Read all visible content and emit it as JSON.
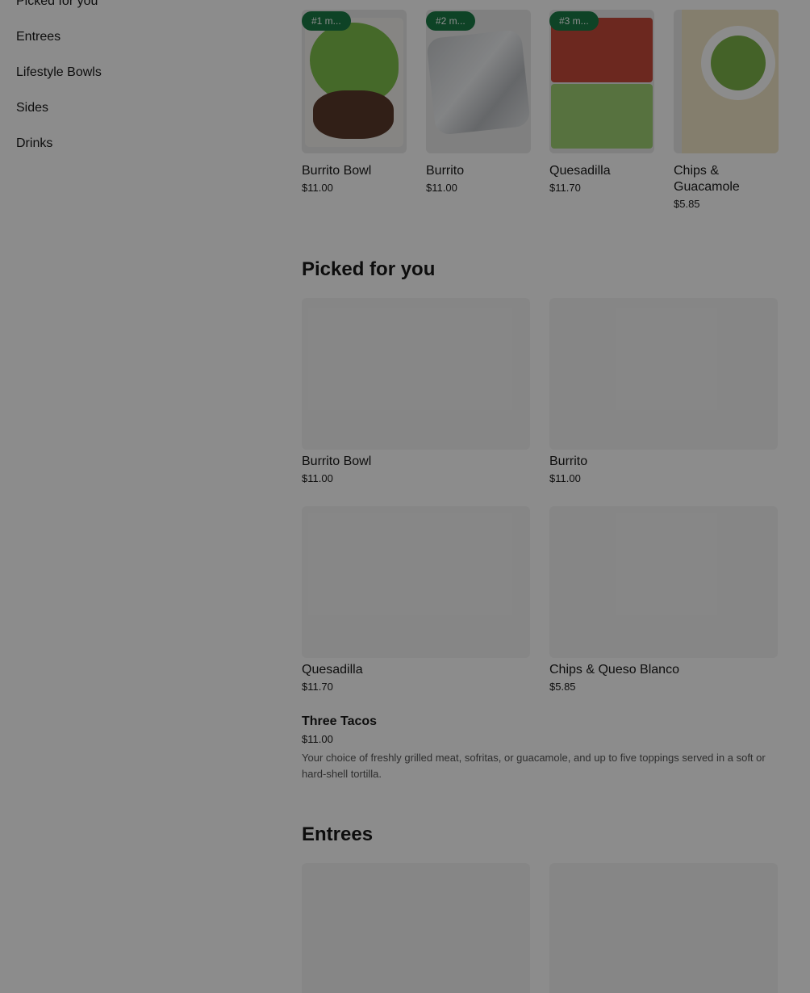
{
  "sidebar": {
    "items": [
      {
        "label": "Picked for you"
      },
      {
        "label": "Entrees"
      },
      {
        "label": "Lifestyle Bowls"
      },
      {
        "label": "Sides"
      },
      {
        "label": "Drinks"
      }
    ]
  },
  "popular": {
    "items": [
      {
        "badge": "#1 m...",
        "name": "Burrito Bowl",
        "price": "$11.00"
      },
      {
        "badge": "#2 m...",
        "name": "Burrito",
        "price": "$11.00"
      },
      {
        "badge": "#3 m...",
        "name": "Quesadilla",
        "price": "$11.70"
      },
      {
        "badge": "",
        "name": "Chips & Guacamole",
        "price": "$5.85"
      }
    ]
  },
  "picked": {
    "title": "Picked for you",
    "items": [
      {
        "name": "Burrito Bowl",
        "price": "$11.00"
      },
      {
        "name": "Burrito",
        "price": "$11.00"
      },
      {
        "name": "Quesadilla",
        "price": "$11.70"
      },
      {
        "name": "Chips & Queso Blanco",
        "price": "$5.85"
      }
    ],
    "row_item": {
      "name": "Three Tacos",
      "price": "$11.00",
      "description": "Your choice of freshly grilled meat, sofritas, or guacamole, and up to five toppings served in a soft or hard-shell tortilla."
    }
  },
  "entrees": {
    "title": "Entrees"
  },
  "colors": {
    "badge": "#1a7a45",
    "overlay": "rgba(0,0,0,0.45)"
  }
}
